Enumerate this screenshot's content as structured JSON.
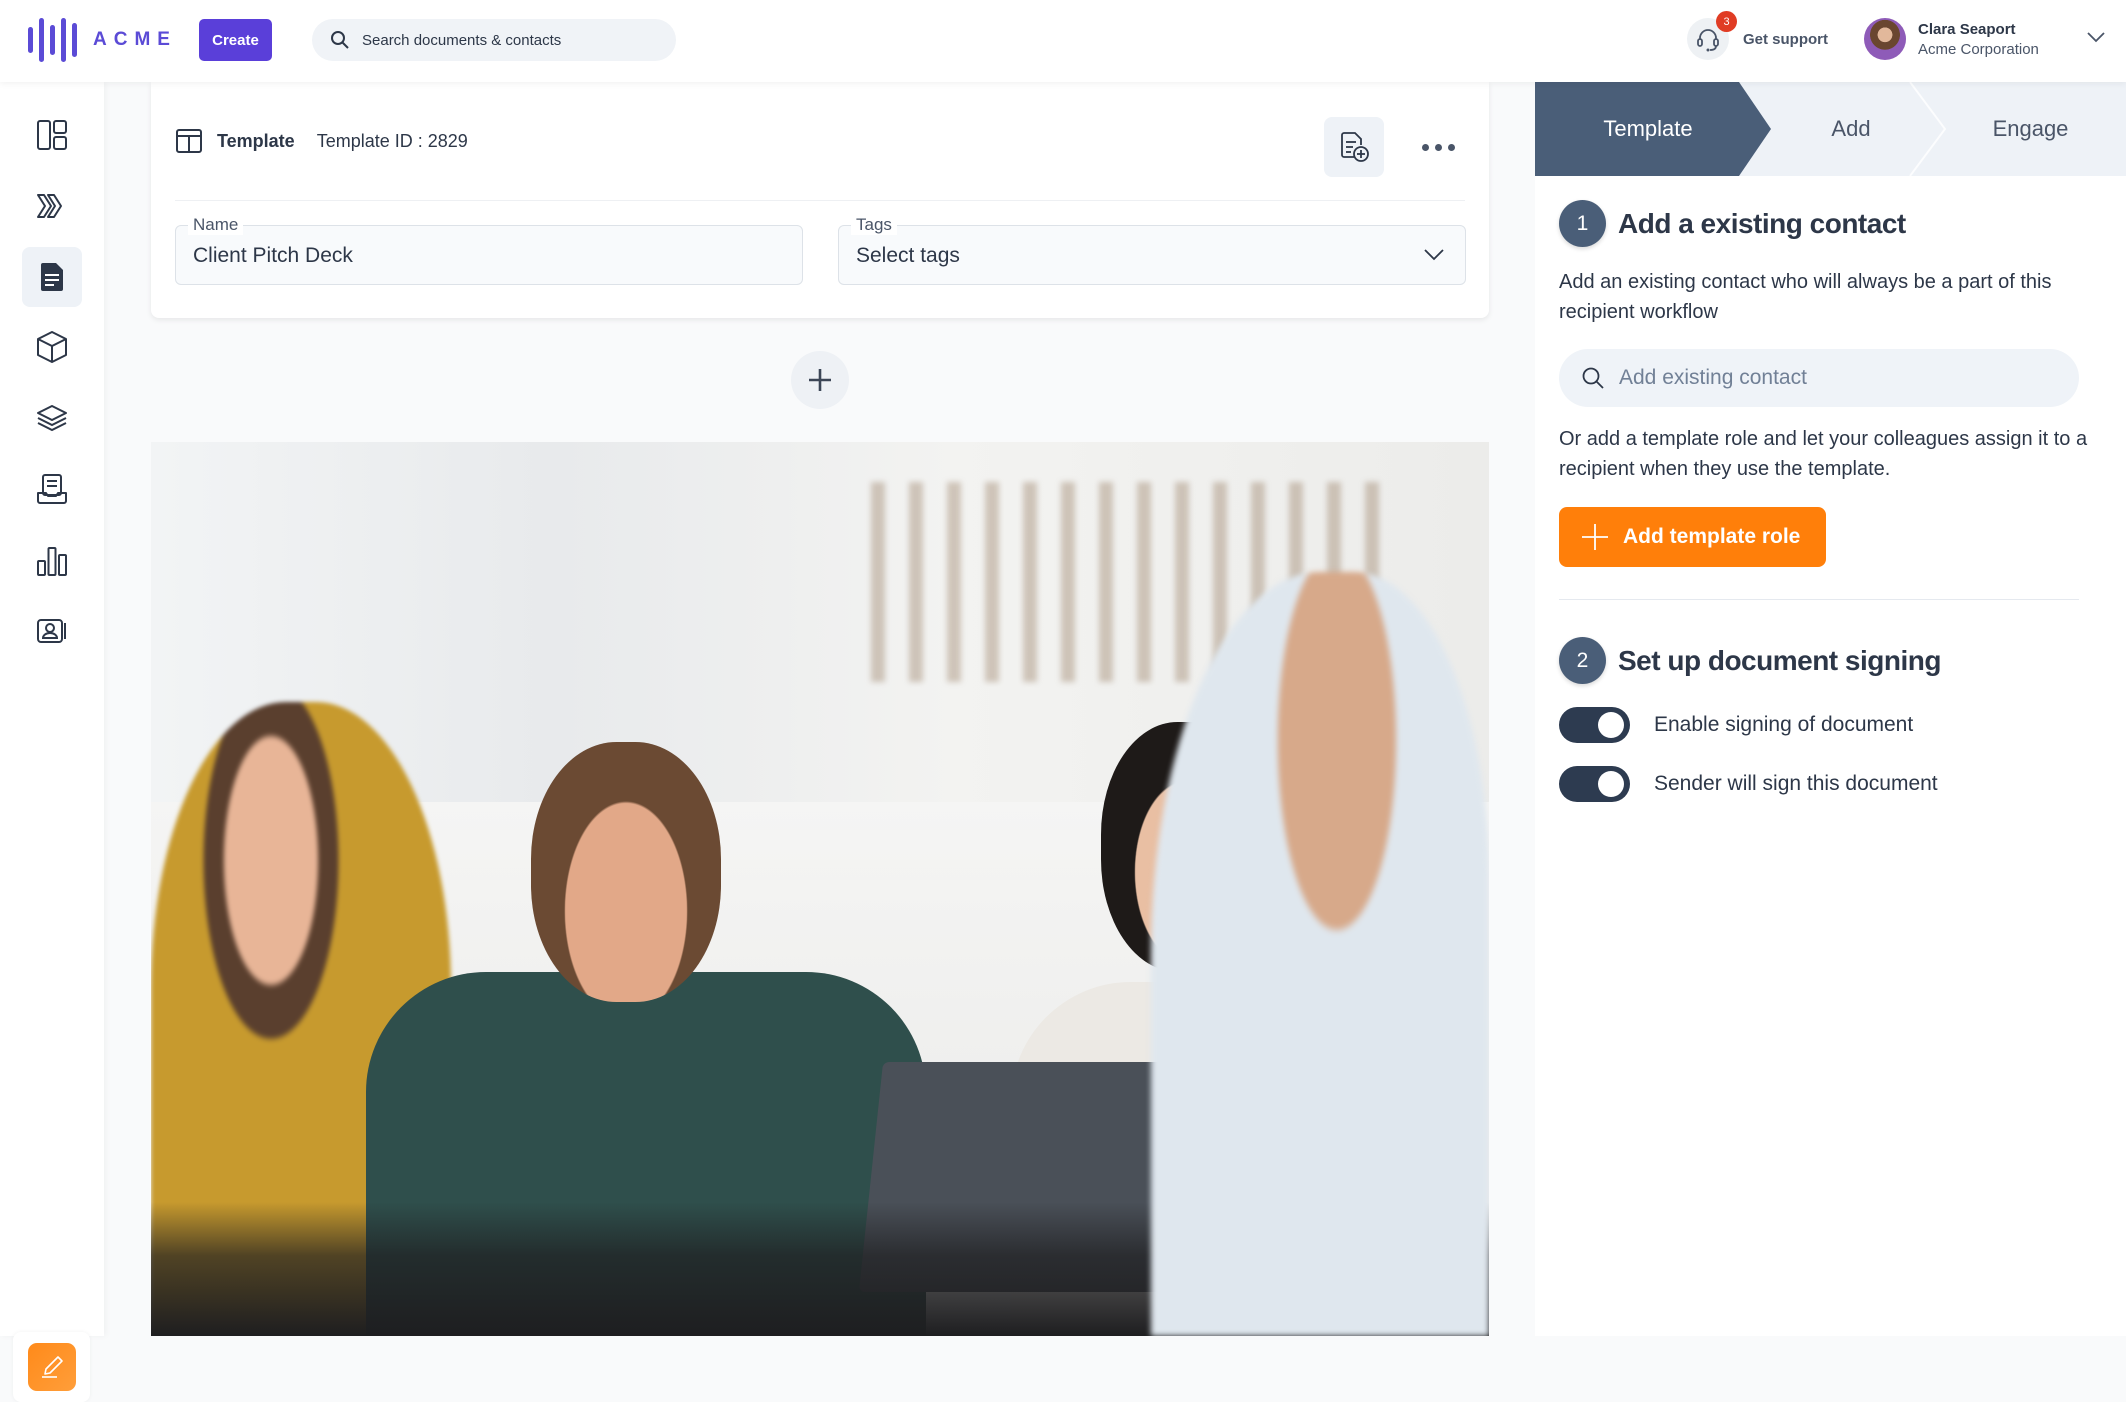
{
  "header": {
    "logo_text": "ACME",
    "create_label": "Create",
    "search_placeholder": "Search documents & contacts",
    "support_label": "Get support",
    "support_badge": "3",
    "user_name": "Clara Seaport",
    "user_org": "Acme Corporation"
  },
  "sidebar": {
    "items": [
      {
        "name": "dashboard",
        "icon": "dashboard-icon"
      },
      {
        "name": "workflows",
        "icon": "chevrons-icon"
      },
      {
        "name": "documents",
        "icon": "document-icon",
        "active": true
      },
      {
        "name": "products",
        "icon": "cube-icon"
      },
      {
        "name": "layers",
        "icon": "layers-icon"
      },
      {
        "name": "inbox",
        "icon": "inbox-icon"
      },
      {
        "name": "reports",
        "icon": "bar-chart-icon"
      },
      {
        "name": "contacts",
        "icon": "contact-card-icon"
      }
    ],
    "sign_button_icon": "pen-icon"
  },
  "card": {
    "title": "Template",
    "template_id": "Template ID : 2829",
    "name_label": "Name",
    "name_value": "Client Pitch Deck",
    "tags_label": "Tags",
    "tags_placeholder": "Select tags"
  },
  "panel": {
    "steps": [
      {
        "label": "Template",
        "active": true
      },
      {
        "label": "Add",
        "active": false
      },
      {
        "label": "Engage",
        "active": false
      }
    ],
    "section1": {
      "number": "1",
      "title": "Add a existing contact",
      "description": "Add an existing contact who will always be a part of this recipient workflow",
      "search_placeholder": "Add existing contact",
      "role_description": "Or add a template role and let your colleagues assign it to a recipient when they use the template.",
      "role_button": "Add template role"
    },
    "section2": {
      "number": "2",
      "title": "Set up document signing",
      "toggles": [
        {
          "label": "Enable signing of document",
          "on": true
        },
        {
          "label": "Sender will sign this document",
          "on": true
        }
      ]
    }
  },
  "colors": {
    "brand": "#5a3fd9",
    "accent_orange": "#ff7f0a",
    "step_active": "#4a5e78",
    "toggle_on": "#2d3b50",
    "badge": "#e03c24"
  }
}
